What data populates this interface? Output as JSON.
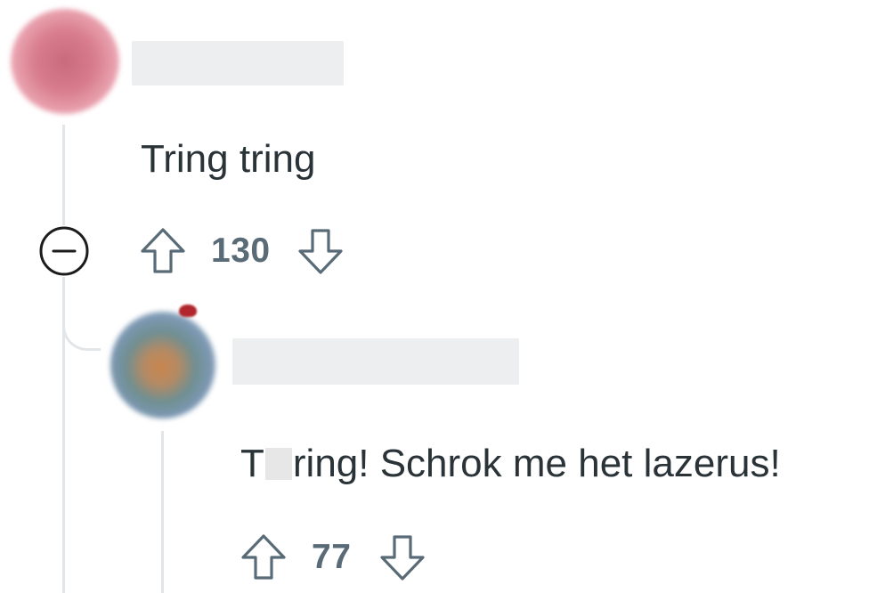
{
  "comments": [
    {
      "username": "",
      "text": "Tring tring",
      "votes": "130",
      "avatar": "user-avatar-blurred",
      "collapse_icon": "minus-circle-icon"
    },
    {
      "username": "",
      "text_before": "T",
      "text_after": "ring! Schrok me het lazerus!",
      "votes": "77",
      "avatar": "user-avatar-blurred"
    }
  ],
  "icons": {
    "upvote": "arrow-up-outline-icon",
    "downvote": "arrow-down-outline-icon"
  },
  "colors": {
    "text": "#2a3338",
    "vote_count": "#5a6b78",
    "thread_line": "#e3e6e8",
    "icon_stroke": "#5a6b78"
  }
}
